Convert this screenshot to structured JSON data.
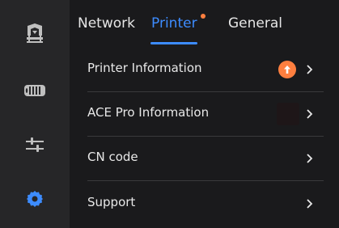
{
  "sidebar": {
    "items": [
      {
        "icon": "printer-icon"
      },
      {
        "icon": "filament-spool-icon"
      },
      {
        "icon": "sliders-icon"
      },
      {
        "icon": "gear-icon",
        "active": true
      }
    ]
  },
  "tabs": [
    {
      "label": "Network",
      "active": false
    },
    {
      "label": "Printer",
      "active": true,
      "notification": true
    },
    {
      "label": "General",
      "active": false
    }
  ],
  "rows": [
    {
      "label": "Printer Information",
      "badge": "update-arrow-icon"
    },
    {
      "label": "ACE Pro Information"
    },
    {
      "label": "CN code"
    },
    {
      "label": "Support"
    }
  ],
  "colors": {
    "accent": "#3d8cff",
    "notification": "#ff7f3f",
    "background": "#1a1a1c",
    "sidebar": "#262628",
    "text": "#e8e8e8"
  }
}
